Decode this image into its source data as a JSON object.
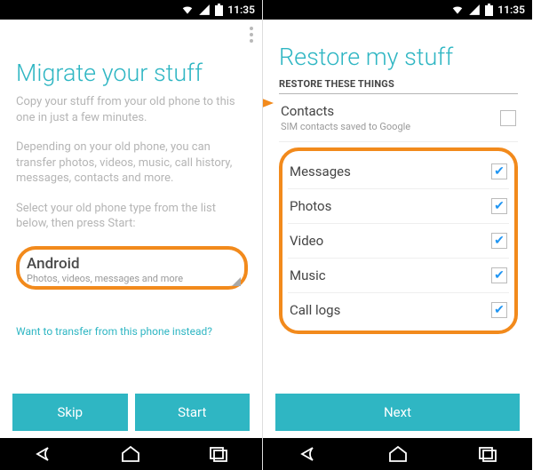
{
  "status": {
    "time": "11:35"
  },
  "left": {
    "title": "Migrate your stuff",
    "subtitle": "Copy your stuff from your old phone to this one in just a few minutes.",
    "para1": "Depending on your old phone, you can transfer photos, videos, music, call history, messages, contacts and more.",
    "para2": "Select your old phone type from the list below, then press Start:",
    "dropdown": {
      "label": "Android",
      "sublabel": "Photos, videos, messages and more"
    },
    "link": "Want to transfer from this phone instead?",
    "buttons": {
      "skip": "Skip",
      "start": "Start"
    }
  },
  "right": {
    "title": "Restore my stuff",
    "section_header": "RESTORE THESE THINGS",
    "contacts": {
      "label": "Contacts",
      "sublabel": "SIM contacts saved to Google",
      "checked": false
    },
    "items": [
      {
        "label": "Messages",
        "checked": true
      },
      {
        "label": "Photos",
        "checked": true
      },
      {
        "label": "Video",
        "checked": true
      },
      {
        "label": "Music",
        "checked": true
      },
      {
        "label": "Call logs",
        "checked": true
      }
    ],
    "button": "Next"
  }
}
